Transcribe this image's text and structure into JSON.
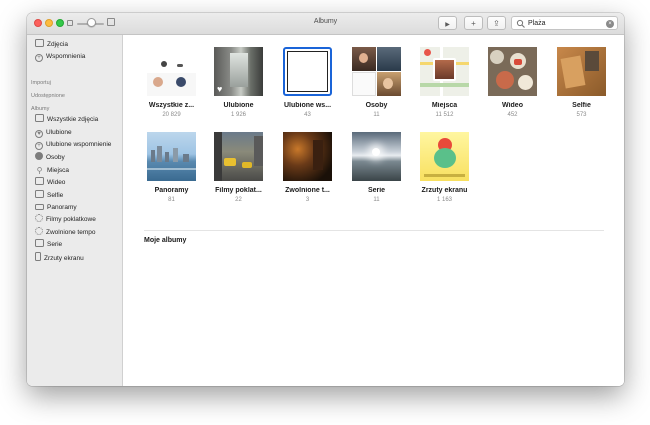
{
  "window": {
    "title": "Albumy"
  },
  "toolbar": {
    "play_icon": "play-icon",
    "play_glyph": "▶",
    "add_glyph": "+",
    "share_glyph": "⇪",
    "search": {
      "value": "Plaża",
      "clear_glyph": "×"
    }
  },
  "sidebar": {
    "top_items": [
      {
        "label": "Zdjęcia",
        "icon": "photos-icon"
      },
      {
        "label": "Wspomnienia",
        "icon": "memories-icon"
      }
    ],
    "section_import": "Importuj",
    "section_shared": "Udostępnione",
    "section_albums": "Albumy",
    "album_items": [
      {
        "label": "Wszystkie zdjęcia",
        "icon": "all-photos-icon"
      },
      {
        "label": "Ulubione",
        "icon": "heart-icon"
      },
      {
        "label": "Ulubione wspomnienie",
        "icon": "favorite-memories-icon"
      },
      {
        "label": "Osoby",
        "icon": "person-icon"
      },
      {
        "label": "Miejsca",
        "icon": "pin-icon"
      },
      {
        "label": "Wideo",
        "icon": "video-icon"
      },
      {
        "label": "Selfie",
        "icon": "selfie-icon"
      },
      {
        "label": "Panoramy",
        "icon": "panorama-icon"
      },
      {
        "label": "Filmy poklatkowe",
        "icon": "timelapse-icon"
      },
      {
        "label": "Zwolnione tempo",
        "icon": "slowmo-icon"
      },
      {
        "label": "Serie",
        "icon": "burst-icon"
      },
      {
        "label": "Zrzuty ekranu",
        "icon": "screenshot-icon"
      }
    ]
  },
  "albums": [
    {
      "label": "Wszystkie z...",
      "count": "20 829"
    },
    {
      "label": "Ulubione",
      "count": "1 926"
    },
    {
      "label": "Ulubione ws...",
      "count": "43"
    },
    {
      "label": "Osoby",
      "count": "11"
    },
    {
      "label": "Miejsca",
      "count": "11 512"
    },
    {
      "label": "Wideo",
      "count": "452"
    },
    {
      "label": "Selfie",
      "count": "573"
    },
    {
      "label": "Panoramy",
      "count": "81"
    },
    {
      "label": "Filmy poklat...",
      "count": "22"
    },
    {
      "label": "Zwolnione t...",
      "count": "3"
    },
    {
      "label": "Serie",
      "count": "11"
    },
    {
      "label": "Zrzuty ekranu",
      "count": "1 163"
    }
  ],
  "my_albums_label": "Moje albumy"
}
